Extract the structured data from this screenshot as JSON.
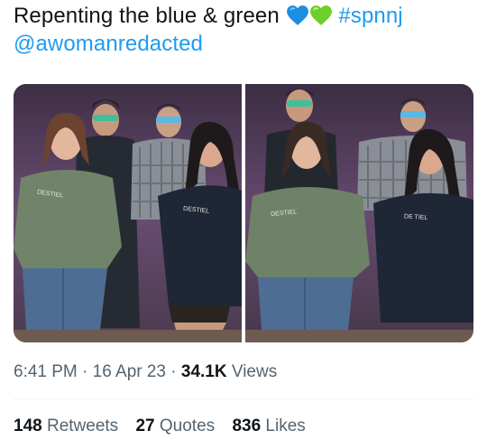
{
  "tweet": {
    "text_line1": "Repenting the blue & green",
    "hearts": [
      "blue-heart",
      "green-heart"
    ],
    "hashtag": "#spnnj",
    "mention": "@awomanredacted"
  },
  "media": {
    "photos": [
      {
        "shirt_text": "DESTIEL",
        "shirt_text_2": "DESTIEL"
      },
      {
        "shirt_text": "DESTIEL",
        "shirt_text_2": "DE TIEL"
      }
    ]
  },
  "meta": {
    "time": "6:41 PM",
    "sep1": "·",
    "date": "16 Apr 23",
    "sep2": "·",
    "views_count": "34.1K",
    "views_label": "Views"
  },
  "stats": {
    "retweets_count": "148",
    "retweets_label": "Retweets",
    "quotes_count": "27",
    "quotes_label": "Quotes",
    "likes_count": "836",
    "likes_label": "Likes"
  },
  "colors": {
    "accent": "#1d9bf0",
    "text": "#0f1419",
    "secondary": "#536471",
    "blue_heart": "#1c8fe0",
    "green_heart": "#6ccf2a"
  }
}
